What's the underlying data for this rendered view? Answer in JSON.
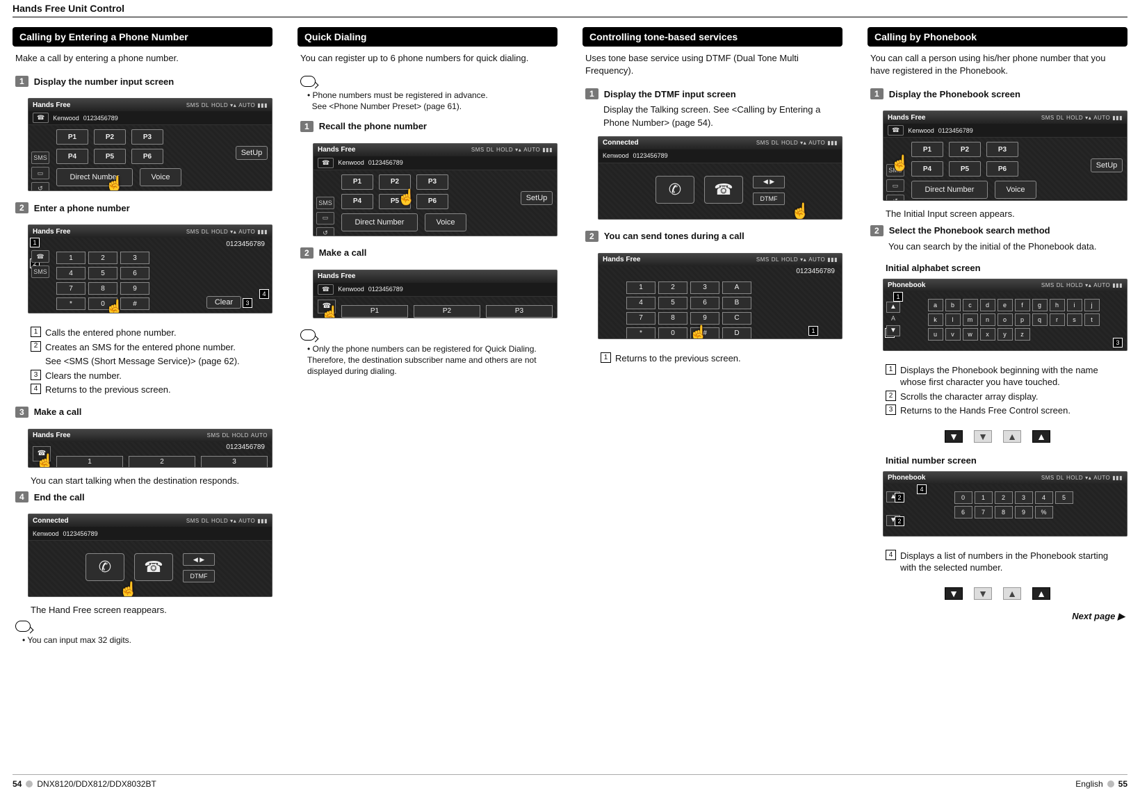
{
  "header": {
    "title": "Hands Free Unit Control"
  },
  "footer": {
    "page_left": "54",
    "model": "DNX8120/DDX812/DDX8032BT",
    "lang": "English",
    "page_right": "55",
    "next": "Next page ▶"
  },
  "shot_common": {
    "hands_free": "Hands Free",
    "connected": "Connected",
    "phonebook": "Phonebook",
    "contact_name": "Kenwood",
    "contact_number": "0123456789",
    "status_sms": "SMS",
    "status_dl": "DL",
    "status_hold": "HOLD",
    "status_sig": "▾▴",
    "status_auto": "AUTO",
    "status_batt": "▮▮▮",
    "side_sms": "SMS",
    "side_book": "▭",
    "side_redial": "↺",
    "side_phone": "☎",
    "p1": "P1",
    "p2": "P2",
    "p3": "P3",
    "p4": "P4",
    "p5": "P5",
    "p6": "P6",
    "direct_number": "Direct Number",
    "voice": "Voice",
    "setup": "SetUp",
    "clear": "Clear",
    "k1": "1",
    "k2": "2",
    "k3": "3",
    "k4": "4",
    "k5": "5",
    "k6": "6",
    "k7": "7",
    "k8": "8",
    "k9": "9",
    "kstar": "*",
    "k0": "0",
    "khash": "#",
    "kA": "A",
    "kB": "B",
    "kC": "C",
    "kD": "D",
    "spk": "◀ ▶",
    "dtmf": "DTMF",
    "alpha": [
      "a",
      "b",
      "c",
      "d",
      "e",
      "f",
      "g",
      "h",
      "i",
      "j",
      "k",
      "l",
      "m",
      "n",
      "o",
      "p",
      "q",
      "r",
      "s",
      "t",
      "u",
      "v",
      "w",
      "x",
      "y",
      "z"
    ],
    "nums": [
      "0",
      "1",
      "2",
      "3",
      "4",
      "5",
      "6",
      "7",
      "8",
      "9",
      "%"
    ],
    "arrow_up": "▲",
    "arrow_down": "▼"
  },
  "col1": {
    "title": "Calling by Entering a Phone Number",
    "intro": "Make a call by entering a phone number.",
    "s1": {
      "n": "1",
      "t": "Display the number input screen"
    },
    "s2": {
      "n": "2",
      "t": "Enter a phone number"
    },
    "leg1": "Calls the entered phone number.",
    "leg2a": "Creates an SMS for the entered phone number.",
    "leg2b": "See <SMS (Short Message Service)> (page 62).",
    "leg3": "Clears the number.",
    "leg4": "Returns to the previous screen.",
    "s3": {
      "n": "3",
      "t": "Make a call"
    },
    "s3_txt": "You can start talking when the destination responds.",
    "s4": {
      "n": "4",
      "t": "End the call"
    },
    "s4_txt": "The Hand Free screen reappears.",
    "note": "You can input max 32 digits."
  },
  "col2": {
    "title": "Quick Dialing",
    "intro": "You can register up to 6 phone numbers for quick dialing.",
    "note1a": "Phone numbers must be registered in advance.",
    "note1b": "See <Phone Number Preset> (page 61).",
    "s1": {
      "n": "1",
      "t": "Recall the phone number"
    },
    "s2": {
      "n": "2",
      "t": "Make a call"
    },
    "note2": "Only the phone numbers can be registered for Quick Dialing. Therefore, the destination subscriber name and others are not displayed during dialing."
  },
  "col3": {
    "title": "Controlling tone-based services",
    "intro": "Uses tone base service using DTMF (Dual Tone Multi Frequency).",
    "s1": {
      "n": "1",
      "t": "Display the DTMF input screen"
    },
    "s1_txt": "Display the Talking screen. See <Calling by Entering a Phone Number> (page 54).",
    "s2": {
      "n": "2",
      "t": "You can send tones during a call"
    },
    "leg1": "Returns to the previous screen."
  },
  "col4": {
    "title": "Calling by Phonebook",
    "intro": "You can call a person using his/her phone number that you have registered in the Phonebook.",
    "s1": {
      "n": "1",
      "t": "Display the Phonebook screen"
    },
    "s1_txt": "The Initial Input screen appears.",
    "s2": {
      "n": "2",
      "t": "Select the Phonebook search method"
    },
    "s2_txt": "You can search by the initial of the Phonebook data.",
    "sub_alpha": "Initial alphabet screen",
    "leg1": "Displays the Phonebook beginning with the name whose first character you have touched.",
    "leg2": "Scrolls the character array display.",
    "leg3": "Returns to the Hands Free Control screen.",
    "sub_num": "Initial number screen",
    "leg4": "Displays a list of numbers in the Phonebook starting with the selected number."
  }
}
